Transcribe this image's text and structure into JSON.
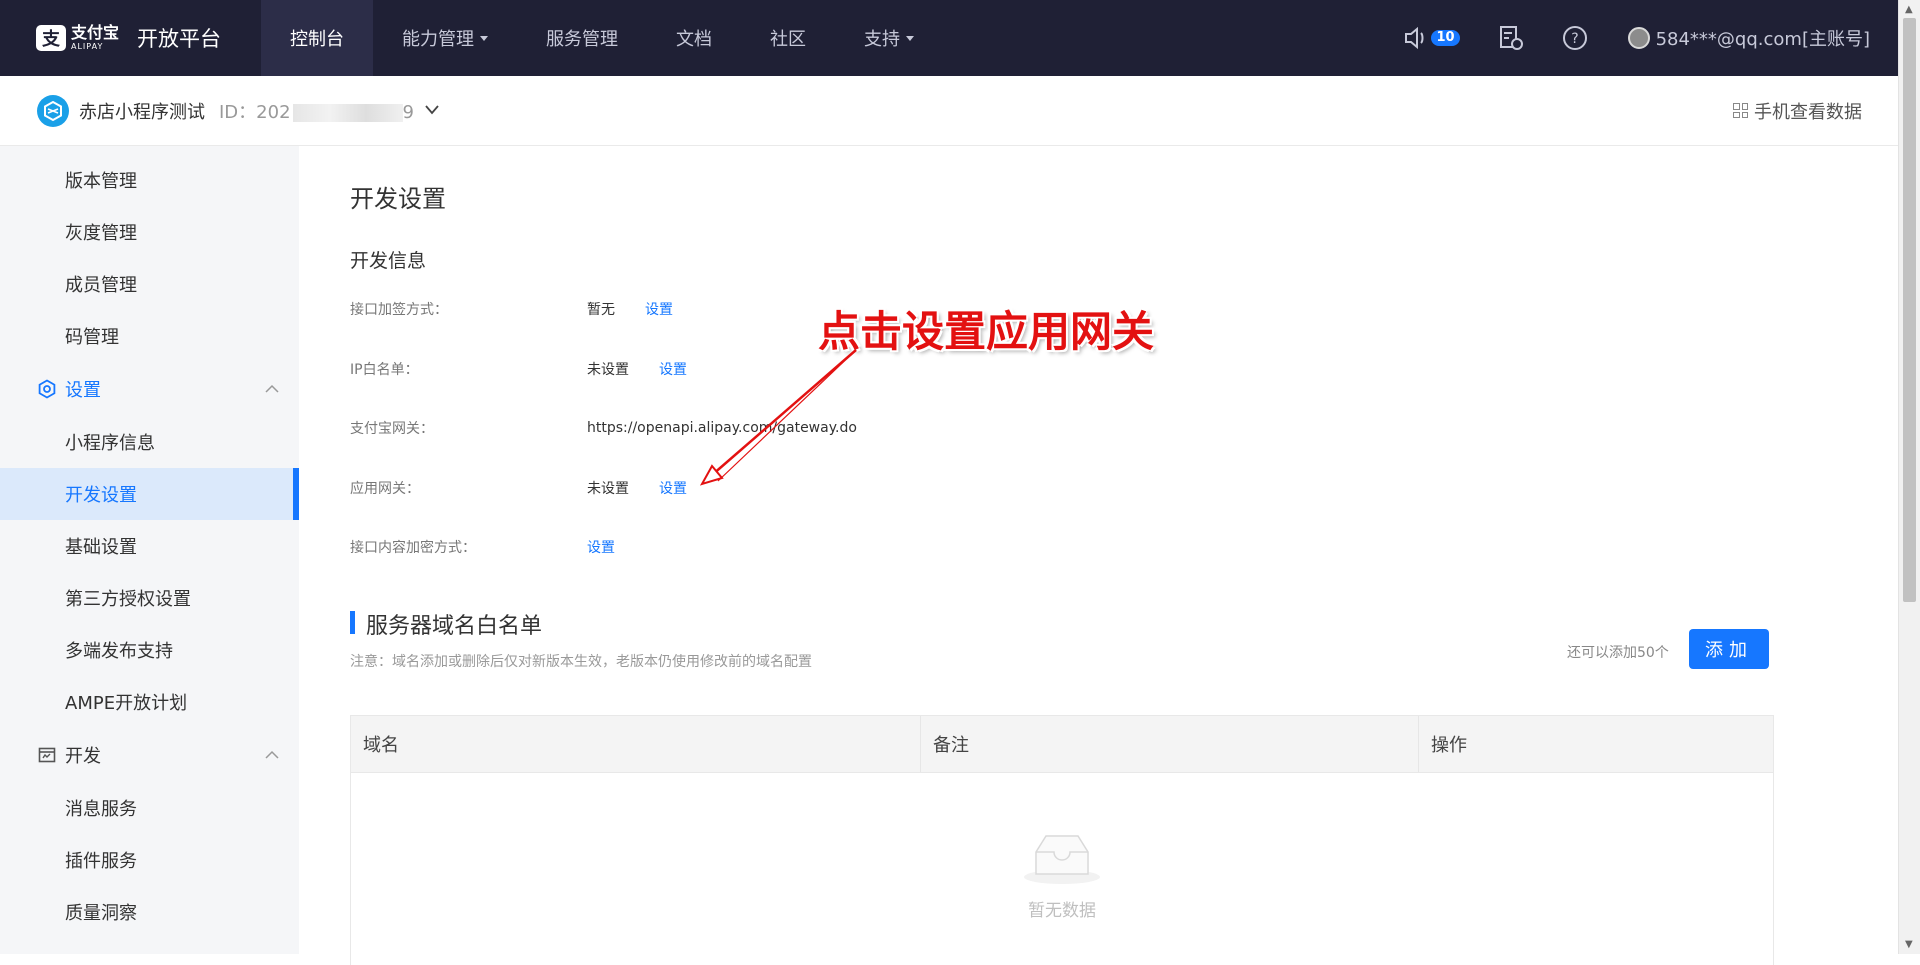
{
  "topbar": {
    "logo_cn": "支付宝",
    "logo_en": "ALIPAY",
    "platform_title": "开放平台",
    "nav": [
      {
        "label": "控制台",
        "active": true,
        "dropdown": false
      },
      {
        "label": "能力管理",
        "active": false,
        "dropdown": true
      },
      {
        "label": "服务管理",
        "active": false,
        "dropdown": false
      },
      {
        "label": "文档",
        "active": false,
        "dropdown": false
      },
      {
        "label": "社区",
        "active": false,
        "dropdown": false
      },
      {
        "label": "支持",
        "active": false,
        "dropdown": true
      }
    ],
    "notification_count": "10",
    "user_account": "584***@qq.com[主账号]"
  },
  "subheader": {
    "app_name": "赤店小程序测试",
    "app_id_prefix": "ID：202",
    "app_id_suffix": "9",
    "mobile_data_label": "手机查看数据"
  },
  "sidebar": {
    "items_top": [
      "版本管理",
      "灰度管理",
      "成员管理",
      "码管理"
    ],
    "group_settings": "设置",
    "settings_items": [
      "小程序信息",
      "开发设置",
      "基础设置",
      "第三方授权设置",
      "多端发布支持",
      "AMPE开放计划"
    ],
    "active_item": "开发设置",
    "group_dev": "开发",
    "dev_items": [
      "消息服务",
      "插件服务",
      "质量洞察"
    ]
  },
  "main": {
    "page_title": "开发设置",
    "section_title": "开发信息",
    "rows": [
      {
        "label": "接口加签方式：",
        "value": "暂无",
        "link": "设置"
      },
      {
        "label": "IP白名单：",
        "value": "未设置",
        "link": "设置"
      },
      {
        "label": "支付宝网关：",
        "value": "https://openapi.alipay.com/gateway.do",
        "link": ""
      },
      {
        "label": "应用网关：",
        "value": "未设置",
        "link": "设置"
      },
      {
        "label": "接口内容加密方式：",
        "value": "",
        "link": "设置"
      }
    ],
    "whitelist": {
      "title": "服务器域名白名单",
      "note": "注意：域名添加或删除后仅对新版本生效，老版本仍使用修改前的域名配置",
      "remaining": "还可以添加50个",
      "add_button": "添加",
      "columns": [
        "域名",
        "备注",
        "操作"
      ],
      "empty_text": "暂无数据"
    }
  },
  "annotation": {
    "text": "点击设置应用网关",
    "color": "#e31111"
  },
  "colors": {
    "topbar_bg": "#1f2035",
    "accent": "#1677ff",
    "sidebar_bg": "#f5f6f8"
  }
}
